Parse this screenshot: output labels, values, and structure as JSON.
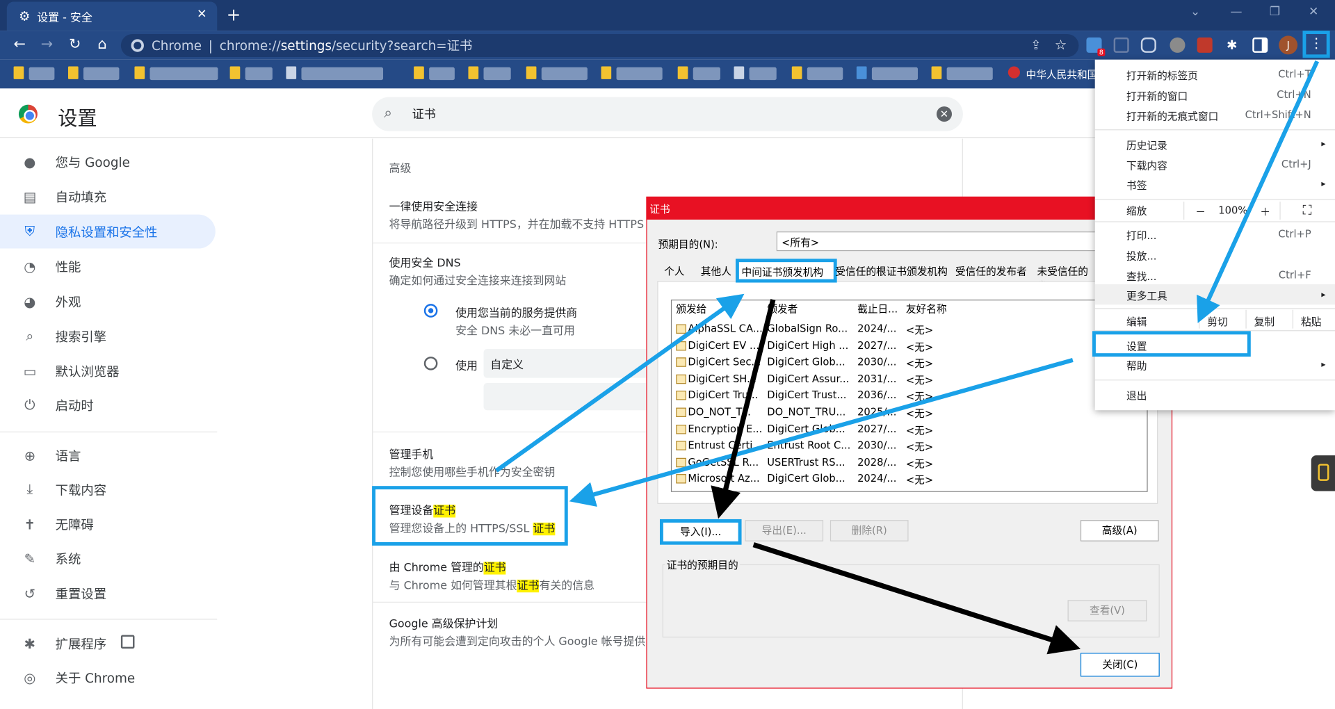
{
  "browser": {
    "tab_title": "设置 - 安全",
    "new_tab_icon": "+",
    "address_prefix": "Chrome",
    "address_separator": "|",
    "address_pre": "chrome://",
    "address_bold": "settings",
    "address_post": "/security?search=证书",
    "bookmark_visible_text": "中华人民共和国",
    "profile_initial": "J",
    "extension_badge": "8"
  },
  "settings": {
    "title": "设置",
    "search_value": "证书",
    "sidebar": [
      {
        "label": "您与 Google",
        "icon": "person-icon"
      },
      {
        "label": "自动填充",
        "icon": "clipboard-icon"
      },
      {
        "label": "隐私设置和安全性",
        "icon": "shield-icon"
      },
      {
        "label": "性能",
        "icon": "speedometer-icon"
      },
      {
        "label": "外观",
        "icon": "palette-icon"
      },
      {
        "label": "搜索引擎",
        "icon": "search-icon"
      },
      {
        "label": "默认浏览器",
        "icon": "browser-icon"
      },
      {
        "label": "启动时",
        "icon": "power-icon"
      },
      {
        "label": "语言",
        "icon": "globe-icon"
      },
      {
        "label": "下载内容",
        "icon": "download-icon"
      },
      {
        "label": "无障碍",
        "icon": "accessibility-icon"
      },
      {
        "label": "系统",
        "icon": "wrench-icon"
      },
      {
        "label": "重置设置",
        "icon": "history-icon"
      },
      {
        "label": "扩展程序",
        "icon": "puzzle-icon"
      },
      {
        "label": "关于 Chrome",
        "icon": "chrome-icon"
      }
    ],
    "section_advanced": "高级",
    "https_title": "一律使用安全连接",
    "https_desc": "将导航路径升级到 HTTPS，并在加载不支持 HTTPS",
    "dns_title": "使用安全 DNS",
    "dns_desc": "确定如何通过安全连接来连接到网站",
    "dns_opt1_title": "使用您当前的服务提供商",
    "dns_opt1_desc": "安全 DNS 未必一直可用",
    "dns_opt2_label": "使用",
    "dns_custom_value": "自定义",
    "phone_title": "管理手机",
    "phone_desc": "控制您使用哪些手机作为安全密钥",
    "certs_title_pre": "管理设备",
    "certs_title_hl": "证书",
    "certs_desc_pre": "管理您设备上的 HTTPS/SSL ",
    "certs_desc_hl": "证书",
    "chrome_certs_pre": "由 Chrome 管理的",
    "chrome_certs_hl": "证书",
    "chrome_certs_desc_pre": "与 Chrome 如何管理其根",
    "chrome_certs_desc_hl": "证书",
    "chrome_certs_desc_post": "有关的信息",
    "gapp_title": "Google 高级保护计划",
    "gapp_desc": "为所有可能会遭到定向攻击的个人 Google 帐号提供"
  },
  "cert_dialog": {
    "title": "证书",
    "purpose_label": "预期目的(N):",
    "purpose_value": "<所有>",
    "tabs": [
      "个人",
      "其他人",
      "中间证书颁发机构",
      "受信任的根证书颁发机构",
      "受信任的发布者",
      "未受信任的发"
    ],
    "columns": [
      "颁发给",
      "颁发者",
      "截止日...",
      "友好名称"
    ],
    "rows": [
      [
        "AlphaSSL CA...",
        "GlobalSign Ro...",
        "2024/...",
        "<无>"
      ],
      [
        "DigiCert EV ...",
        "DigiCert High ...",
        "2027/...",
        "<无>"
      ],
      [
        "DigiCert Sec...",
        "DigiCert Glob...",
        "2030/...",
        "<无>"
      ],
      [
        "DigiCert SH...",
        "DigiCert Assur...",
        "2031/...",
        "<无>"
      ],
      [
        "DigiCert Tru...",
        "DigiCert Trust...",
        "2036/...",
        "<无>"
      ],
      [
        "DO_NOT_T...",
        "DO_NOT_TRU...",
        "2025/...",
        "<无>"
      ],
      [
        "Encryption E...",
        "DigiCert Glob...",
        "2027/...",
        "<无>"
      ],
      [
        "Entrust Certi...",
        "Entrust Root C...",
        "2030/...",
        "<无>"
      ],
      [
        "GoGetSSL R...",
        "USERTrust RS...",
        "2028/...",
        "<无>"
      ],
      [
        "Microsoft Az...",
        "DigiCert Glob...",
        "2024/...",
        "<无>"
      ]
    ],
    "btn_import": "导入(I)...",
    "btn_export": "导出(E)...",
    "btn_delete": "删除(R)",
    "btn_advanced": "高级(A)",
    "purposes_group": "证书的预期目的",
    "btn_view": "查看(V)",
    "btn_close": "关闭(C)"
  },
  "menu": {
    "items": [
      {
        "label": "打开新的标签页",
        "shortcut": "Ctrl+T"
      },
      {
        "label": "打开新的窗口",
        "shortcut": "Ctrl+N"
      },
      {
        "label": "打开新的无痕式窗口",
        "shortcut": "Ctrl+Shift+N"
      },
      {
        "label": "历史记录",
        "shortcut": ""
      },
      {
        "label": "下载内容",
        "shortcut": "Ctrl+J"
      },
      {
        "label": "书签",
        "shortcut": ""
      },
      {
        "label": "缩放",
        "shortcut": ""
      },
      {
        "label": "打印...",
        "shortcut": "Ctrl+P"
      },
      {
        "label": "投放...",
        "shortcut": ""
      },
      {
        "label": "查找...",
        "shortcut": "Ctrl+F"
      },
      {
        "label": "更多工具",
        "shortcut": ""
      },
      {
        "label": "编辑",
        "shortcut": ""
      },
      {
        "label": "设置",
        "shortcut": ""
      },
      {
        "label": "帮助",
        "shortcut": ""
      },
      {
        "label": "退出",
        "shortcut": ""
      }
    ],
    "zoom_minus": "－",
    "zoom_value": "100%",
    "zoom_plus": "＋",
    "edit_cut": "剪切",
    "edit_copy": "复制",
    "edit_paste": "粘贴"
  },
  "colors": {
    "chrome_dark": "#1c3a6e",
    "chrome_mid": "#254a86",
    "annotation_blue": "#1aa1e8",
    "dialog_red": "#e81123",
    "highlight": "#fff200"
  }
}
